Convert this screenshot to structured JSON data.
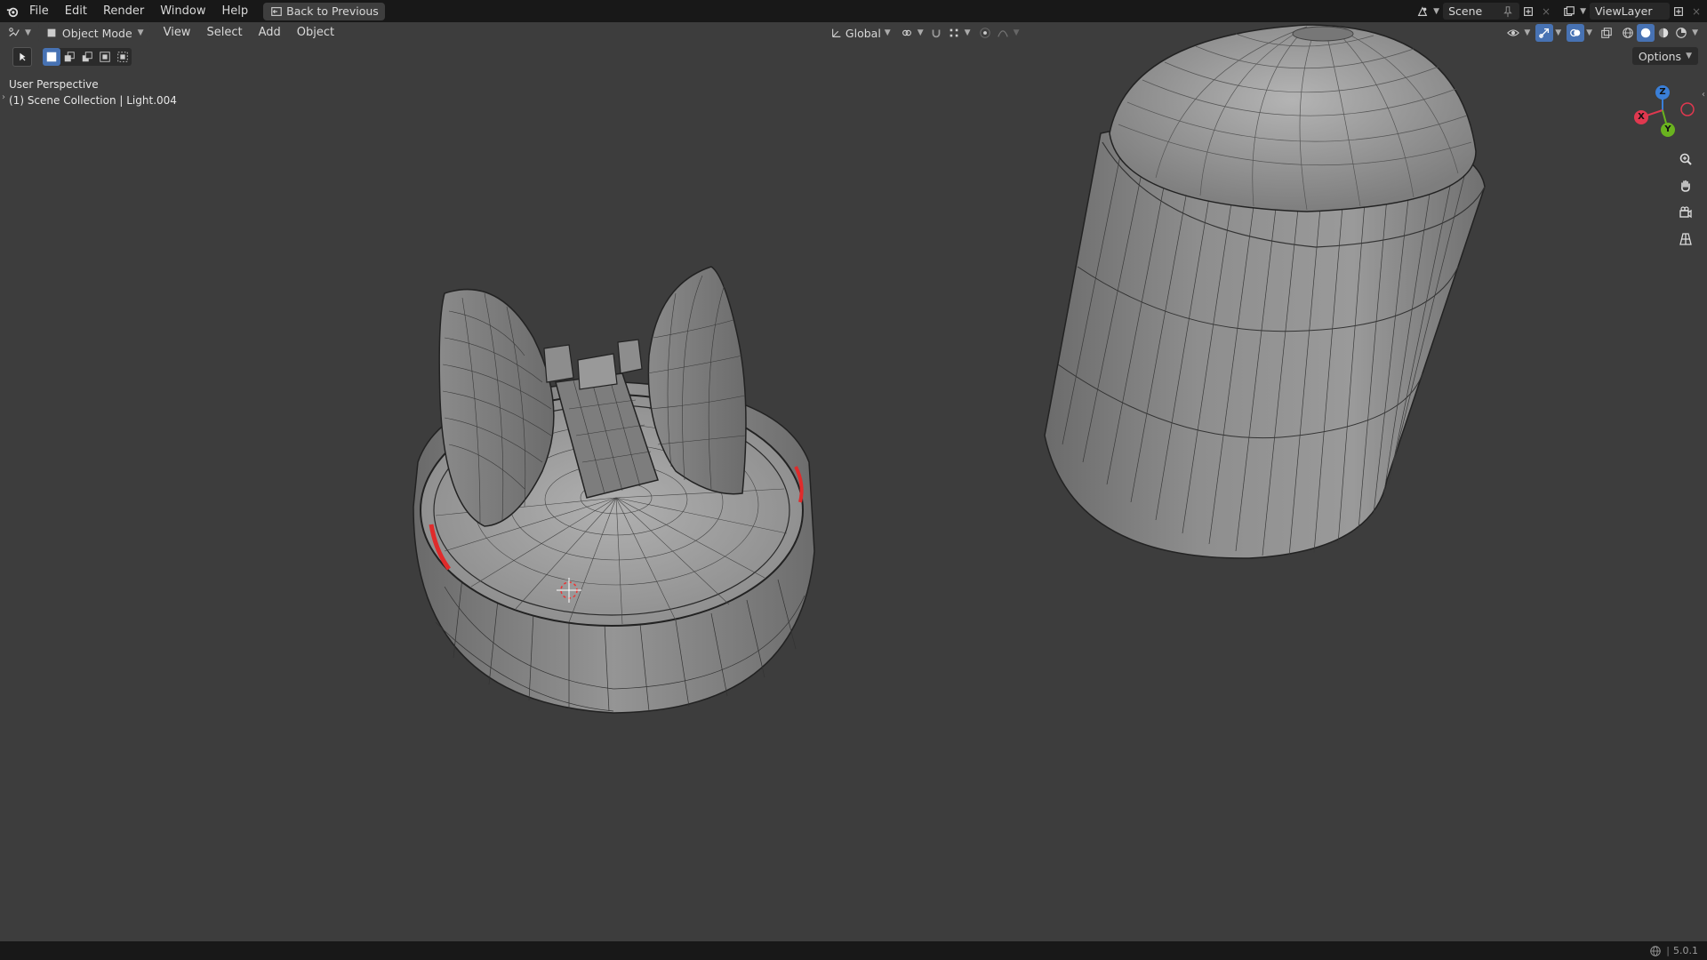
{
  "menubar": {
    "items": [
      "File",
      "Edit",
      "Render",
      "Window",
      "Help"
    ],
    "back_button": "Back to Previous",
    "scene": "Scene",
    "view_layer": "ViewLayer"
  },
  "header": {
    "mode": "Object Mode",
    "menus": [
      "View",
      "Select",
      "Add",
      "Object"
    ],
    "transform_orientation": "Global",
    "options_label": "Options"
  },
  "viewport": {
    "perspective_label": "User Perspective",
    "collection_label": "(1) Scene Collection | Light.004",
    "gizmo": {
      "x": "X",
      "y": "Y",
      "z": "Z"
    }
  },
  "status": {
    "version": "5.0.1"
  },
  "colors": {
    "x_axis": "#e0384f",
    "y_axis": "#6ab31f",
    "z_axis": "#3a7fd8",
    "mesh_fill": "#8f8f8f",
    "wire": "#1c1c1c",
    "highlight_red": "#e02b2b"
  }
}
